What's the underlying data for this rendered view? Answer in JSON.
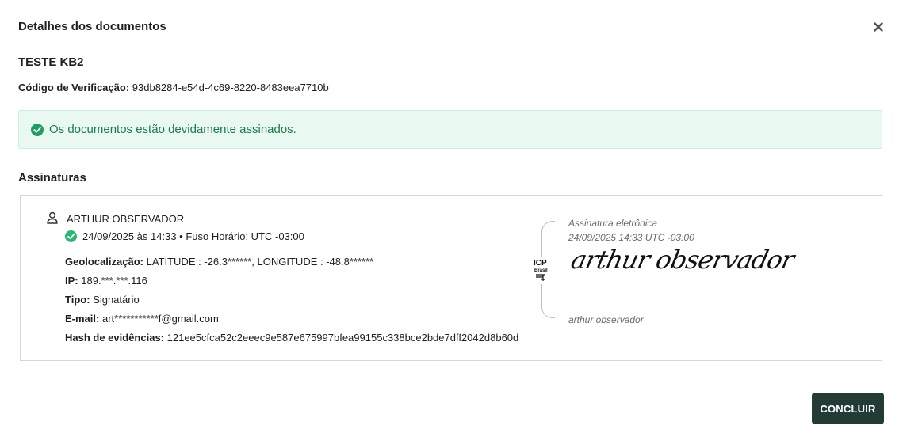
{
  "modal": {
    "title": "Detalhes dos documentos",
    "close_icon": "close-icon"
  },
  "document": {
    "name": "TESTE KB2",
    "verification_label": "Código de Verificação:",
    "verification_code": "93db8284-e54d-4c69-8220-8483eea7710b"
  },
  "alert": {
    "icon": "check-circle-icon",
    "message": "Os documentos estão devidamente assinados.",
    "color": "#1f7a4f",
    "background": "#e9f8f1"
  },
  "signatures": {
    "title": "Assinaturas",
    "items": [
      {
        "name": "ARTHUR OBSERVADOR",
        "datetime": "24/09/2025 às 14:33 • Fuso Horário: UTC -03:00",
        "geo_label": "Geolocalização:",
        "geo_value": "LATITUDE : -26.3******, LONGITUDE : -48.8******",
        "ip_label": "IP:",
        "ip_value": "189.***.***.116",
        "type_label": "Tipo:",
        "type_value": "Signatário",
        "email_label": "E-mail:",
        "email_value": "art***********f@gmail.com",
        "hash_label": "Hash de evidências:",
        "hash_value": "121ee5cfca52c2eeec9e587e675997bfea99155c338bce2bde7dff2042d8b60d",
        "stamp": {
          "label": "Assinatura eletrônica",
          "datetime": "24/09/2025 14:33 UTC -03:00",
          "cursive": "arthur observador",
          "printed_name": "arthur observador",
          "logo_text": "ICP Brasil"
        }
      }
    ]
  },
  "footer": {
    "conclude_label": "CONCLUIR",
    "button_color": "#233b35"
  }
}
